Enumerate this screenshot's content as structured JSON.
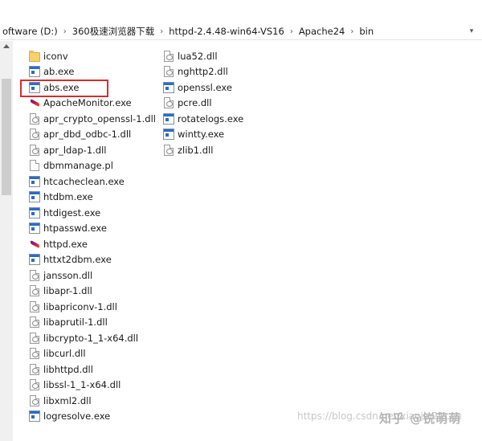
{
  "breadcrumb": {
    "items": [
      "oftware (D:)",
      "360极速浏览器下载",
      "httpd-2.4.48-win64-VS16",
      "Apache24",
      "bin"
    ]
  },
  "files": {
    "left": [
      {
        "name": "iconv",
        "type": "folder"
      },
      {
        "name": "ab.exe",
        "type": "exe"
      },
      {
        "name": "abs.exe",
        "type": "exe"
      },
      {
        "name": "ApacheMonitor.exe",
        "type": "feather"
      },
      {
        "name": "apr_crypto_openssl-1.dll",
        "type": "dll"
      },
      {
        "name": "apr_dbd_odbc-1.dll",
        "type": "dll"
      },
      {
        "name": "apr_ldap-1.dll",
        "type": "dll"
      },
      {
        "name": "dbmmanage.pl",
        "type": "pl"
      },
      {
        "name": "htcacheclean.exe",
        "type": "exe"
      },
      {
        "name": "htdbm.exe",
        "type": "exe"
      },
      {
        "name": "htdigest.exe",
        "type": "exe"
      },
      {
        "name": "htpasswd.exe",
        "type": "exe"
      },
      {
        "name": "httpd.exe",
        "type": "feather"
      },
      {
        "name": "httxt2dbm.exe",
        "type": "exe"
      },
      {
        "name": "jansson.dll",
        "type": "dll"
      },
      {
        "name": "libapr-1.dll",
        "type": "dll"
      },
      {
        "name": "libapriconv-1.dll",
        "type": "dll"
      },
      {
        "name": "libaprutil-1.dll",
        "type": "dll"
      },
      {
        "name": "libcrypto-1_1-x64.dll",
        "type": "dll"
      },
      {
        "name": "libcurl.dll",
        "type": "dll"
      },
      {
        "name": "libhttpd.dll",
        "type": "dll"
      },
      {
        "name": "libssl-1_1-x64.dll",
        "type": "dll"
      },
      {
        "name": "libxml2.dll",
        "type": "dll"
      },
      {
        "name": "logresolve.exe",
        "type": "exe"
      }
    ],
    "right": [
      {
        "name": "lua52.dll",
        "type": "dll"
      },
      {
        "name": "nghttp2.dll",
        "type": "dll"
      },
      {
        "name": "openssl.exe",
        "type": "exe"
      },
      {
        "name": "pcre.dll",
        "type": "dll"
      },
      {
        "name": "rotatelogs.exe",
        "type": "exe"
      },
      {
        "name": "wintty.exe",
        "type": "exe"
      },
      {
        "name": "zlib1.dll",
        "type": "dll"
      }
    ]
  },
  "highlight_color": "#d32f2f",
  "watermark": {
    "url": "https://blog.csdn.net/xiaojin21cen",
    "brand": "知乎 @锐萌萌"
  }
}
